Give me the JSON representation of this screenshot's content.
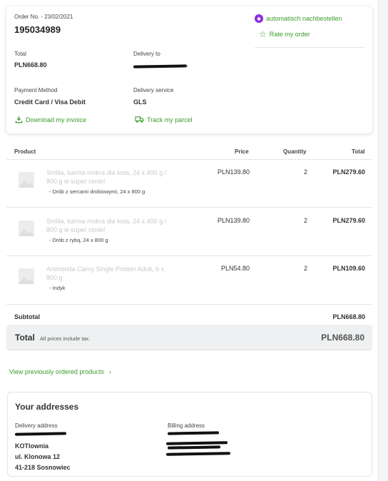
{
  "order": {
    "number_label": "Order No. - 23/02/2021",
    "id": "195034989",
    "reorder_label": "automatisch nachbestellen",
    "rate_label": "Rate my order",
    "total_label": "Total",
    "total_value": "PLN668.80",
    "delivery_to_label": "Delivery to",
    "payment_label": "Payment Method",
    "payment_value": "Credit Card / Visa Debit",
    "service_label": "Delivery service",
    "service_value": "GLS",
    "invoice_link": "Download my invoice",
    "track_link": "Track my parcel"
  },
  "table": {
    "headers": {
      "product": "Product",
      "price": "Price",
      "quantity": "Quantity",
      "total": "Total"
    },
    "rows": [
      {
        "name": "Smilla, karma mokra dla kota, 24 x 400 g / 800 g w super cenie!",
        "variant": "- Drób z sercami drobiowymi, 24 x 800 g",
        "price": "PLN139.80",
        "qty": "2",
        "total": "PLN279.60"
      },
      {
        "name": "Smilla, karma mokra dla kota, 24 x 400 g / 800 g w super cenie!",
        "variant": "- Drób z rybą, 24 x 800 g",
        "price": "PLN139.80",
        "qty": "2",
        "total": "PLN279.60"
      },
      {
        "name": "Animonda Carny Single Protein Adult, 6 x 800 g",
        "variant": "- Indyk",
        "price": "PLN54.80",
        "qty": "2",
        "total": "PLN109.60"
      }
    ]
  },
  "summary": {
    "subtotal_label": "Subtotal",
    "subtotal_value": "PLN668.80",
    "total_label": "Total",
    "tax_note": "All prices include tax.",
    "total_value": "PLN668.80"
  },
  "previous_link": "View previously ordered products",
  "addresses": {
    "title": "Your addresses",
    "delivery_label": "Delivery address",
    "billing_label": "Billing address",
    "delivery_lines": [
      "KOTlownia",
      "ul. Klonowa 12",
      "41-218 Sosnowiec"
    ]
  },
  "colors": {
    "accent": "#3c9a2b",
    "badge": "#8a2be2"
  }
}
